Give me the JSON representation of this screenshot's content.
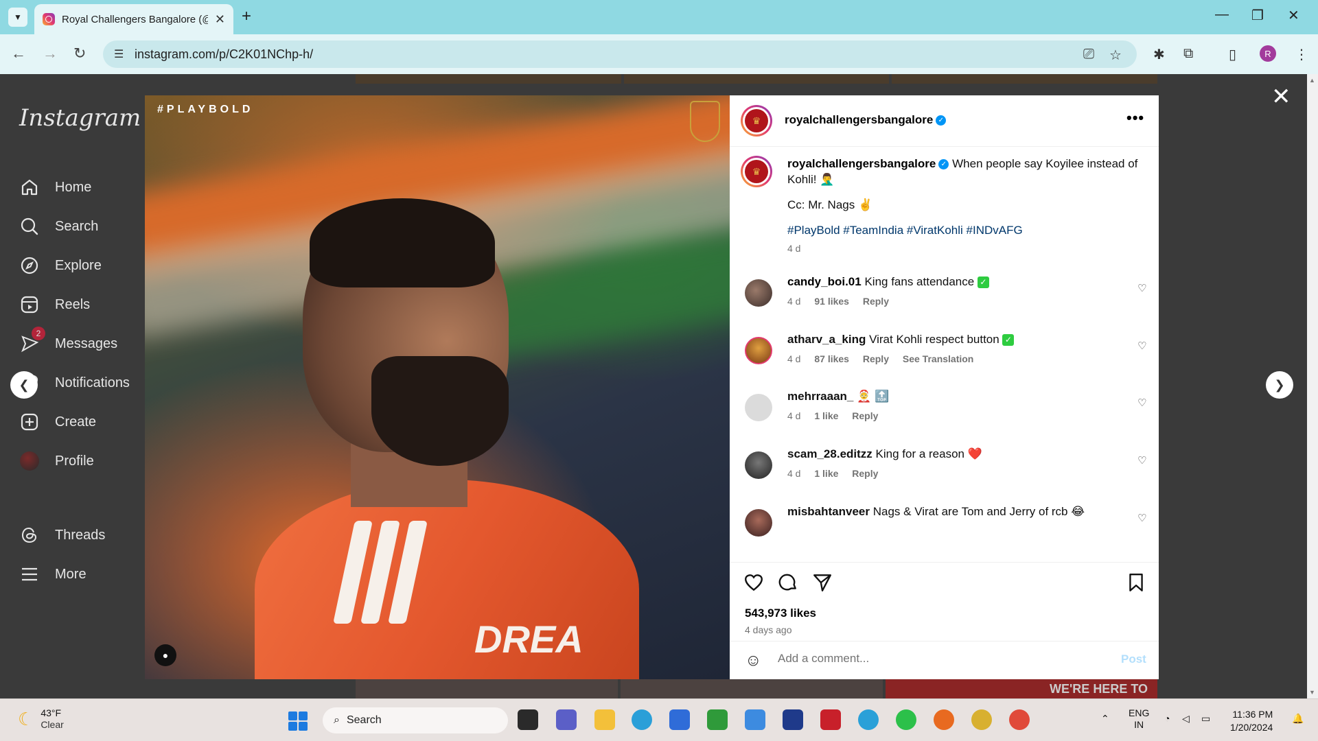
{
  "browser": {
    "tab_title": "Royal Challengers Bangalore (@",
    "url": "instagram.com/p/C2K01NChp-h/",
    "profile_initial": "R"
  },
  "sidebar": {
    "logo": "Instagram",
    "items": [
      {
        "label": "Home",
        "icon": "home-icon"
      },
      {
        "label": "Search",
        "icon": "search-icon"
      },
      {
        "label": "Explore",
        "icon": "explore-icon"
      },
      {
        "label": "Reels",
        "icon": "reels-icon"
      },
      {
        "label": "Messages",
        "icon": "messages-icon",
        "badge": "2"
      },
      {
        "label": "Notifications",
        "icon": "heart-icon"
      },
      {
        "label": "Create",
        "icon": "create-icon"
      },
      {
        "label": "Profile",
        "icon": "profile-avatar"
      }
    ],
    "threads": "Threads",
    "more": "More"
  },
  "post": {
    "image_tag": "#PLAYBOLD",
    "image_text": "DREA",
    "author": "royalchallengersbangalore",
    "caption_lines": [
      "When people say Koyilee instead of Kohli! 🤦‍♂️",
      "Cc: Mr. Nags ✌️"
    ],
    "hashtags": "#PlayBold #TeamIndia #ViratKohli #INDvAFG",
    "caption_age": "4 d",
    "likes": "543,973 likes",
    "posted": "4 days ago",
    "comment_placeholder": "Add a comment...",
    "post_label": "Post"
  },
  "comments": [
    {
      "user": "candy_boi.01",
      "text": "King fans attendance",
      "check": true,
      "age": "4 d",
      "likes": "91 likes",
      "reply": "Reply",
      "extra": ""
    },
    {
      "user": "atharv_a_king",
      "text": "Virat Kohli respect button",
      "check": true,
      "age": "4 d",
      "likes": "87 likes",
      "reply": "Reply",
      "extra": "See Translation"
    },
    {
      "user": "mehrraaan_",
      "text": "🤶 🔝",
      "check": false,
      "age": "4 d",
      "likes": "1 like",
      "reply": "Reply",
      "extra": ""
    },
    {
      "user": "scam_28.editzz",
      "text": "King for a reason ❤️",
      "check": false,
      "age": "4 d",
      "likes": "1 like",
      "reply": "Reply",
      "extra": ""
    },
    {
      "user": "misbahtanveer",
      "text": "Nags & Virat are Tom and Jerry of rcb 😂",
      "check": false,
      "age": "",
      "likes": "",
      "reply": "",
      "extra": ""
    }
  ],
  "taskbar": {
    "temp": "43°F",
    "condition": "Clear",
    "search": "Search",
    "lang1": "ENG",
    "lang2": "IN",
    "time": "11:36 PM",
    "date": "1/20/2024"
  },
  "background_banner": "WE'RE HERE TO"
}
